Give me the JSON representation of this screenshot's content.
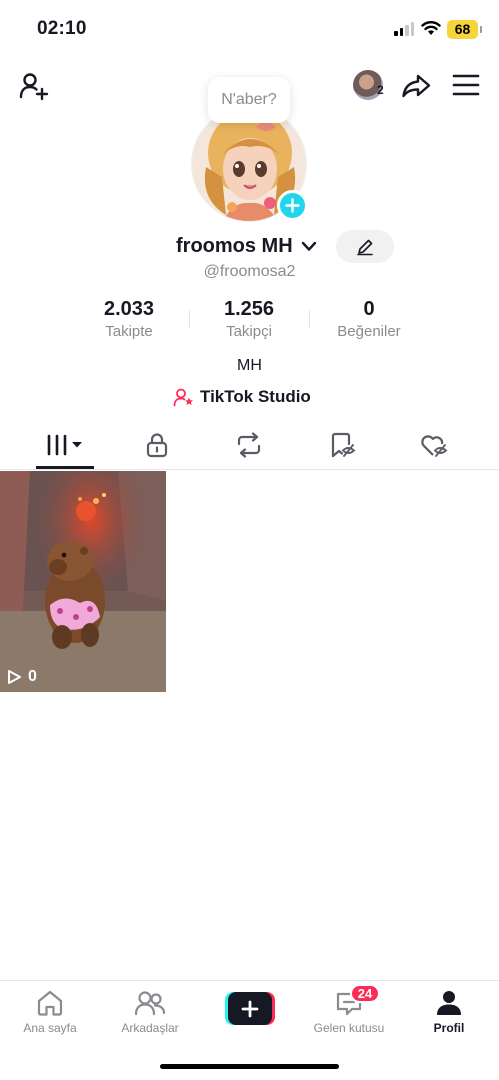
{
  "status_bar": {
    "time": "02:10",
    "battery": "68"
  },
  "top_nav": {
    "add_friend_icon": "person-plus-icon",
    "story_count": "2",
    "share_icon": "share-arrow-icon",
    "menu_icon": "hamburger-icon"
  },
  "profile": {
    "tooltip": "N'aber?",
    "display_name": "froomos MH",
    "handle": "@froomosa2",
    "bio": "MH",
    "studio_link": "TikTok Studio",
    "stats": [
      {
        "value": "2.033",
        "label": "Takipte"
      },
      {
        "value": "1.256",
        "label": "Takipçi"
      },
      {
        "value": "0",
        "label": "Beğeniler"
      }
    ]
  },
  "tabs": [
    {
      "icon": "videos-grid-icon",
      "active": true
    },
    {
      "icon": "lock-icon",
      "active": false
    },
    {
      "icon": "repost-icon",
      "active": false
    },
    {
      "icon": "favorites-hidden-icon",
      "active": false
    },
    {
      "icon": "liked-hidden-icon",
      "active": false
    }
  ],
  "videos": [
    {
      "views": "0"
    }
  ],
  "bottom_nav": {
    "home": "Ana sayfa",
    "friends": "Arkadaşlar",
    "inbox": "Gelen kutusu",
    "inbox_badge": "24",
    "profile": "Profil"
  },
  "colors": {
    "accent": "#fe2c55",
    "cyan": "#25f4ee",
    "add_button": "#20d5ec",
    "battery": "#f6d43b"
  }
}
